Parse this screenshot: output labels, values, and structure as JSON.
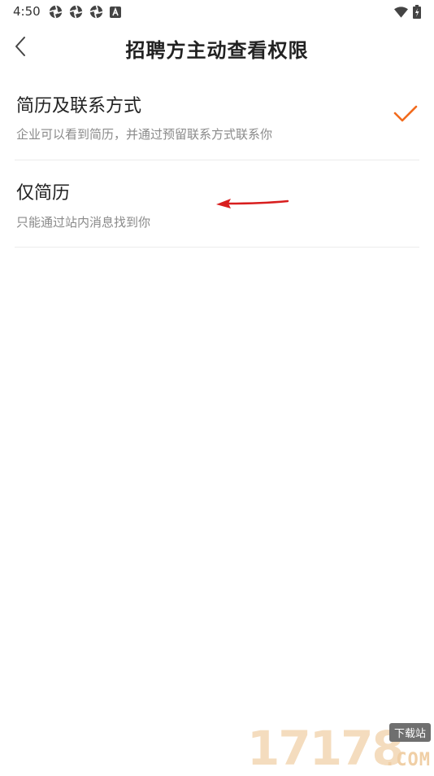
{
  "status_bar": {
    "time": "4:50",
    "left_icons": [
      "aperture-icon",
      "aperture-icon",
      "aperture-icon",
      "font-icon"
    ],
    "right_icons": [
      "wifi-icon",
      "battery-icon"
    ]
  },
  "header": {
    "title": "招聘方主动查看权限",
    "back_icon": "chevron-left-icon"
  },
  "options": [
    {
      "title": "简历及联系方式",
      "description": "企业可以看到简历，并通过预留联系方式联系你",
      "selected": true
    },
    {
      "title": "仅简历",
      "description": "只能通过站内消息找到你",
      "selected": false
    }
  ],
  "accent_color": "#f26b1d",
  "annotation_color": "#d81e1e",
  "watermark": {
    "digits": "17178",
    "badge": "下载站",
    "suffix": ".COM"
  }
}
